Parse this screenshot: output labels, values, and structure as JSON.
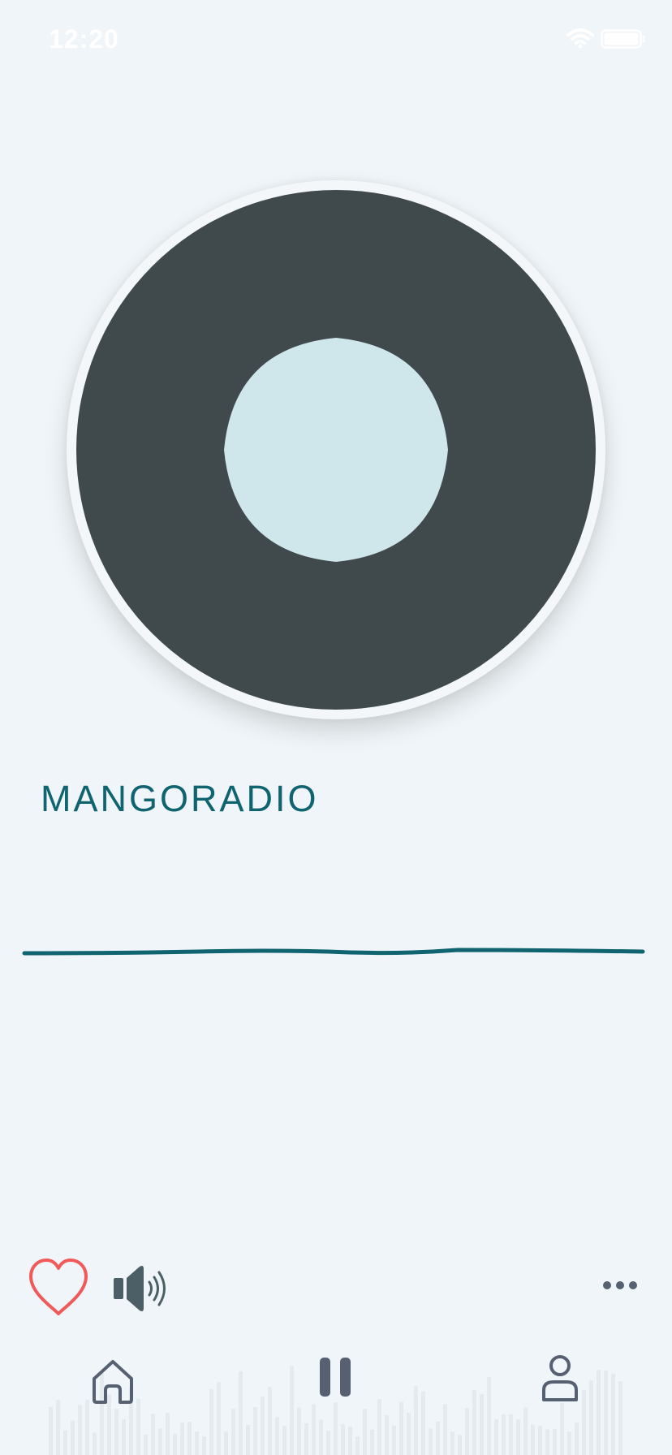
{
  "status_bar": {
    "time": "12:20",
    "icons": [
      "wifi-icon",
      "battery-icon"
    ]
  },
  "player": {
    "station_name": "MANGORADIO",
    "artwork_colors": {
      "disc": "#40494c",
      "center": "#cfe6eb",
      "rim": "#f3f7f9"
    },
    "waveform_color": "#0f6470"
  },
  "controls": {
    "favorite_icon": "heart-outline-icon",
    "favorite_color": "#f05a5a",
    "volume_icon": "speaker-icon",
    "more_icon": "more-dots-icon"
  },
  "tab_bar": {
    "tabs": [
      {
        "name": "home",
        "icon": "home-icon"
      },
      {
        "name": "play-pause",
        "icon": "pause-icon"
      },
      {
        "name": "profile",
        "icon": "user-icon"
      }
    ],
    "icon_color": "#566070"
  }
}
